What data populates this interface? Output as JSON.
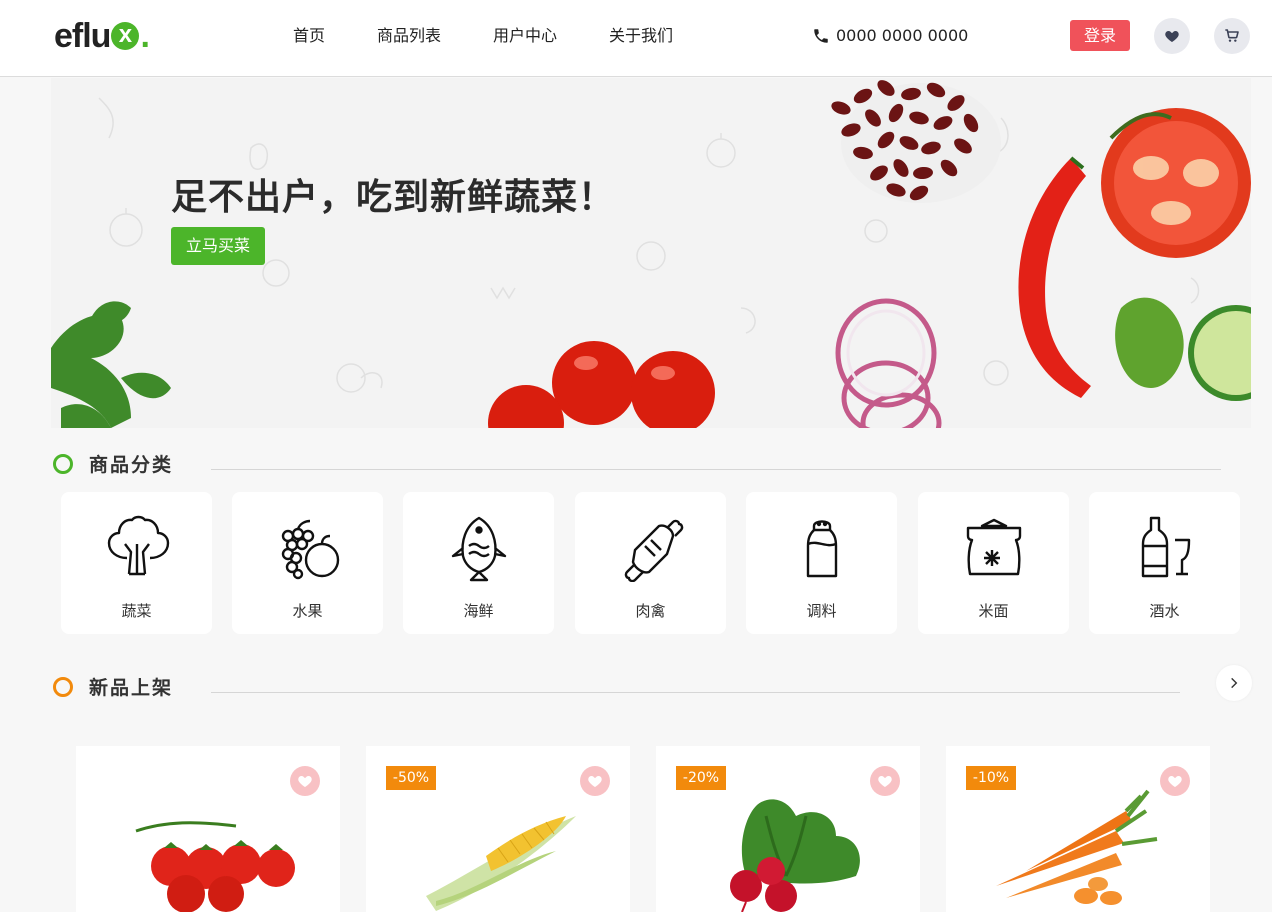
{
  "header": {
    "logo_text": "eflu",
    "logo_mark": "x",
    "logo_dot": ".",
    "nav": [
      "首页",
      "商品列表",
      "用户中心",
      "关于我们"
    ],
    "phone": "0000 0000 0000",
    "login_label": "登录"
  },
  "banner": {
    "headline": "足不出户，吃到新鲜蔬菜！",
    "cta_label": "立马买菜"
  },
  "categories_section": {
    "title": "商品分类",
    "items": [
      {
        "label": "蔬菜",
        "icon": "broccoli-icon"
      },
      {
        "label": "水果",
        "icon": "fruit-icon"
      },
      {
        "label": "海鲜",
        "icon": "fish-icon"
      },
      {
        "label": "肉禽",
        "icon": "meat-icon"
      },
      {
        "label": "调料",
        "icon": "salt-shaker-icon"
      },
      {
        "label": "米面",
        "icon": "rice-sack-icon"
      },
      {
        "label": "酒水",
        "icon": "wine-icon"
      }
    ]
  },
  "new_section": {
    "title": "新品上架",
    "products": [
      {
        "badge": "",
        "image": "tomatoes"
      },
      {
        "badge": "-50%",
        "image": "corn"
      },
      {
        "badge": "-20%",
        "image": "radish"
      },
      {
        "badge": "-10%",
        "image": "carrots"
      }
    ]
  },
  "colors": {
    "brand_green": "#4cb52a",
    "login_red": "#f0525a",
    "badge_orange": "#f28a0c",
    "fav_pink": "#f8c1c4"
  }
}
